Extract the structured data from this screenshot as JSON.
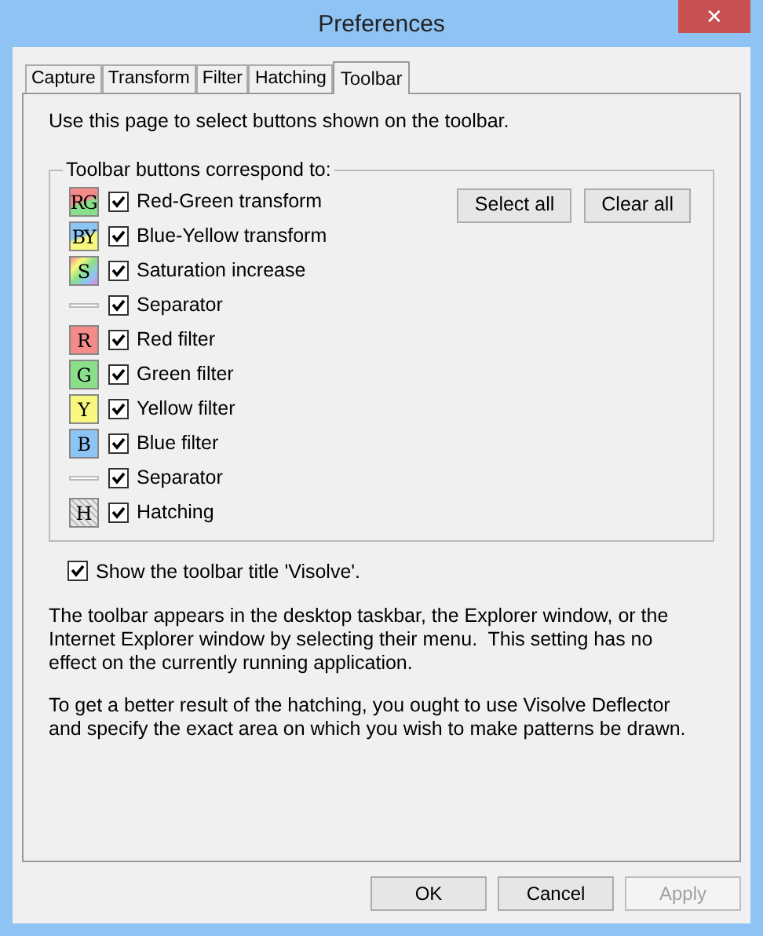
{
  "window": {
    "title": "Preferences",
    "close": "✕"
  },
  "tabs": [
    {
      "label": "Capture",
      "selected": false
    },
    {
      "label": "Transform",
      "selected": false
    },
    {
      "label": "Filter",
      "selected": false
    },
    {
      "label": "Hatching",
      "selected": false
    },
    {
      "label": "Toolbar",
      "selected": true
    }
  ],
  "intro": "Use this page to select buttons shown on the toolbar.",
  "group": {
    "title": "Toolbar buttons correspond to:",
    "items": [
      {
        "kind": "red-green",
        "icon_text": "RG",
        "label": "Red-Green transform",
        "checked": true
      },
      {
        "kind": "blue-yellow",
        "icon_text": "BY",
        "label": "Blue-Yellow transform",
        "checked": true
      },
      {
        "kind": "rainbow",
        "icon_text": "S",
        "label": "Saturation increase",
        "checked": true
      },
      {
        "kind": "separator",
        "label": "Separator",
        "checked": true
      },
      {
        "kind": "solid",
        "color": "#f58a8a",
        "icon_text": "R",
        "label": "Red filter",
        "checked": true
      },
      {
        "kind": "solid",
        "color": "#8ae08a",
        "icon_text": "G",
        "label": "Green filter",
        "checked": true
      },
      {
        "kind": "solid",
        "color": "#f8f880",
        "icon_text": "Y",
        "label": "Yellow filter",
        "checked": true
      },
      {
        "kind": "solid",
        "color": "#8cc4f5",
        "icon_text": "B",
        "label": "Blue filter",
        "checked": true
      },
      {
        "kind": "separator",
        "label": "Separator",
        "checked": true
      },
      {
        "kind": "hatch",
        "icon_text": "H",
        "label": "Hatching",
        "checked": true
      }
    ],
    "buttons": [
      "Select all",
      "Clear all"
    ]
  },
  "show_title": {
    "label": "Show the toolbar title 'Visolve'.",
    "checked": true
  },
  "notes": [
    "The toolbar appears in the desktop taskbar, the Explorer window, or the Internet Explorer window by selecting their menu.  This setting has no effect on the currently running application.",
    "To get a better result of the hatching, you ought to use Visolve Deflector and specify the exact area on which you wish to make patterns be drawn."
  ],
  "footer": [
    {
      "label": "OK",
      "disabled": false
    },
    {
      "label": "Cancel",
      "disabled": false
    },
    {
      "label": "Apply",
      "disabled": true
    }
  ]
}
